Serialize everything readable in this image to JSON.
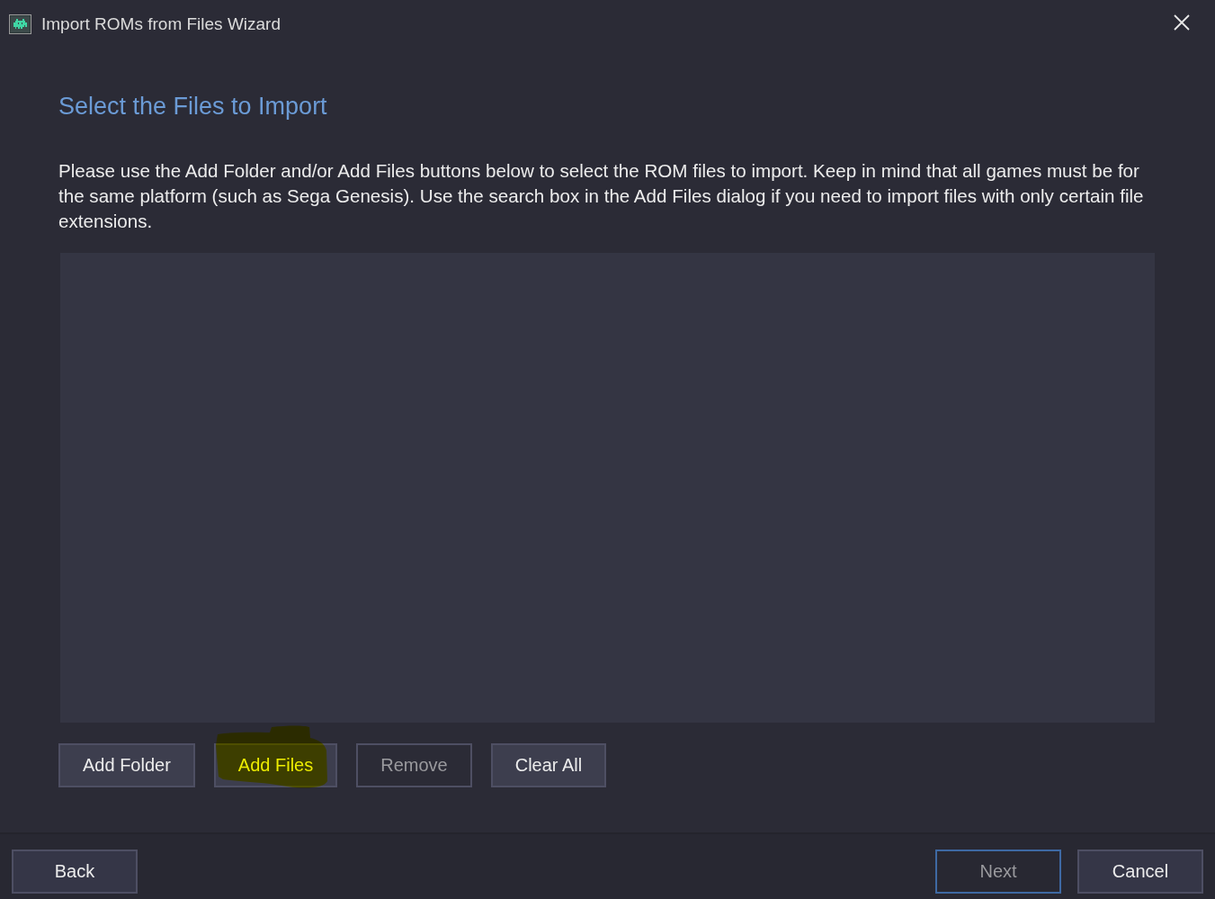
{
  "window": {
    "title": "Import ROMs from Files Wizard"
  },
  "page": {
    "heading": "Select the Files to Import",
    "description": "Please use the Add Folder and/or Add Files buttons below to select the ROM files to import. Keep in mind that all games must be for the same platform (such as Sega Genesis). Use the search box in the Add Files dialog if you need to import files with only certain file extensions."
  },
  "list_buttons": [
    {
      "label": "Add Folder",
      "disabled": false,
      "highlighted": false
    },
    {
      "label": "Add Files",
      "disabled": false,
      "highlighted": true
    },
    {
      "label": "Remove",
      "disabled": true,
      "highlighted": false
    },
    {
      "label": "Clear All",
      "disabled": false,
      "highlighted": false
    }
  ],
  "nav_buttons": [
    {
      "label": "Back",
      "disabled": false,
      "default": false
    },
    {
      "label": "Next",
      "disabled": true,
      "default": true
    },
    {
      "label": "Cancel",
      "disabled": false,
      "default": false
    }
  ]
}
